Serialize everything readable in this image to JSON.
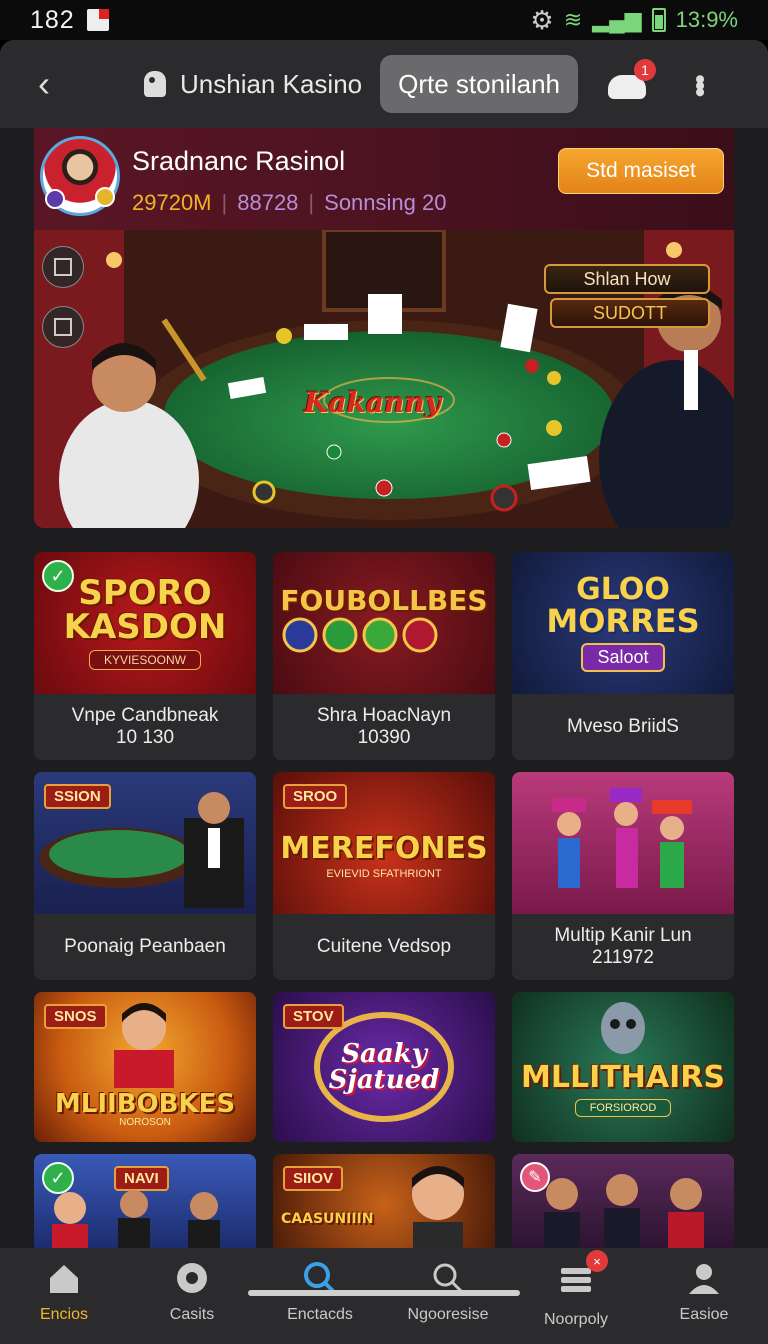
{
  "status": {
    "time": "182",
    "battery": "13:9%"
  },
  "topbar": {
    "app_title": "Unshian Kasino",
    "pill_label": "Qrte stonilanh",
    "notif_count": "1"
  },
  "profile": {
    "name": "Sradnanc Rasinol",
    "coins": "29720M",
    "xp": "88728",
    "level": "Sonnsing 20",
    "action_label": "Std masiset"
  },
  "hero": {
    "tag1": "Shlan How",
    "tag2": "SUDOTT",
    "table_logo": "Kakanny"
  },
  "games": [
    {
      "logo_line1": "SPORO",
      "logo_line2": "KASDON",
      "sub": "KYVIESOONW",
      "title": "Vnpe Candbneak",
      "count": "10 130",
      "badge": "check"
    },
    {
      "logo_line1": "FOUBOLLBES",
      "logo_line2": "",
      "sub": "",
      "title": "Shra HoacNayn",
      "count": "10390",
      "badge": ""
    },
    {
      "logo_line1": "GLOO",
      "logo_line2": "MORRES",
      "sub": "Saloot",
      "title": "Mveso BriidS",
      "count": "",
      "badge": ""
    },
    {
      "logo_line1": "SSION",
      "logo_line2": "",
      "sub": "",
      "title": "Poonaig Peanbaen",
      "count": "",
      "badge": ""
    },
    {
      "logo_line1": "SROO",
      "logo_line2": "MEREFONES",
      "sub": "EVIEVID SFATHRIONT",
      "title": "Cuitene Vedsop",
      "count": "",
      "badge": ""
    },
    {
      "logo_line1": "",
      "logo_line2": "",
      "sub": "",
      "title": "Multip Kanir Lun",
      "count": "211972",
      "badge": ""
    },
    {
      "logo_line1": "SNOS",
      "logo_line2": "MLIIBOBKES",
      "sub": "NOROSON",
      "title": "",
      "count": "",
      "badge": ""
    },
    {
      "logo_line1": "STOV",
      "logo_line2": "Saaky Sjatued",
      "sub": "",
      "title": "",
      "count": "",
      "badge": ""
    },
    {
      "logo_line1": "MLLITHAIRS",
      "logo_line2": "",
      "sub": "FORSIOROD",
      "title": "",
      "count": "",
      "badge": ""
    },
    {
      "logo_line1": "NAVI",
      "logo_line2": "",
      "sub": "",
      "title": "",
      "count": "",
      "badge": "check"
    },
    {
      "logo_line1": "SIIOV",
      "logo_line2": "CAASUNIIIN",
      "sub": "",
      "title": "",
      "count": "",
      "badge": ""
    },
    {
      "logo_line1": "",
      "logo_line2": "",
      "sub": "",
      "title": "",
      "count": "",
      "badge": "edit"
    }
  ],
  "nav": [
    {
      "label": "Encios",
      "icon": "home-icon",
      "active": true
    },
    {
      "label": "Casits",
      "icon": "chip-icon",
      "active": false
    },
    {
      "label": "Enctacds",
      "icon": "search-icon",
      "active": false
    },
    {
      "label": "Ngooresise",
      "icon": "magnify-icon",
      "active": false
    },
    {
      "label": "Noorpoly",
      "icon": "cards-icon",
      "active": false,
      "badge": "×"
    },
    {
      "label": "Easioe",
      "icon": "profile-icon",
      "active": false
    }
  ],
  "colors": {
    "accent": "#f2b52a",
    "button": "#e38318",
    "felt": "#1f7a3a"
  }
}
